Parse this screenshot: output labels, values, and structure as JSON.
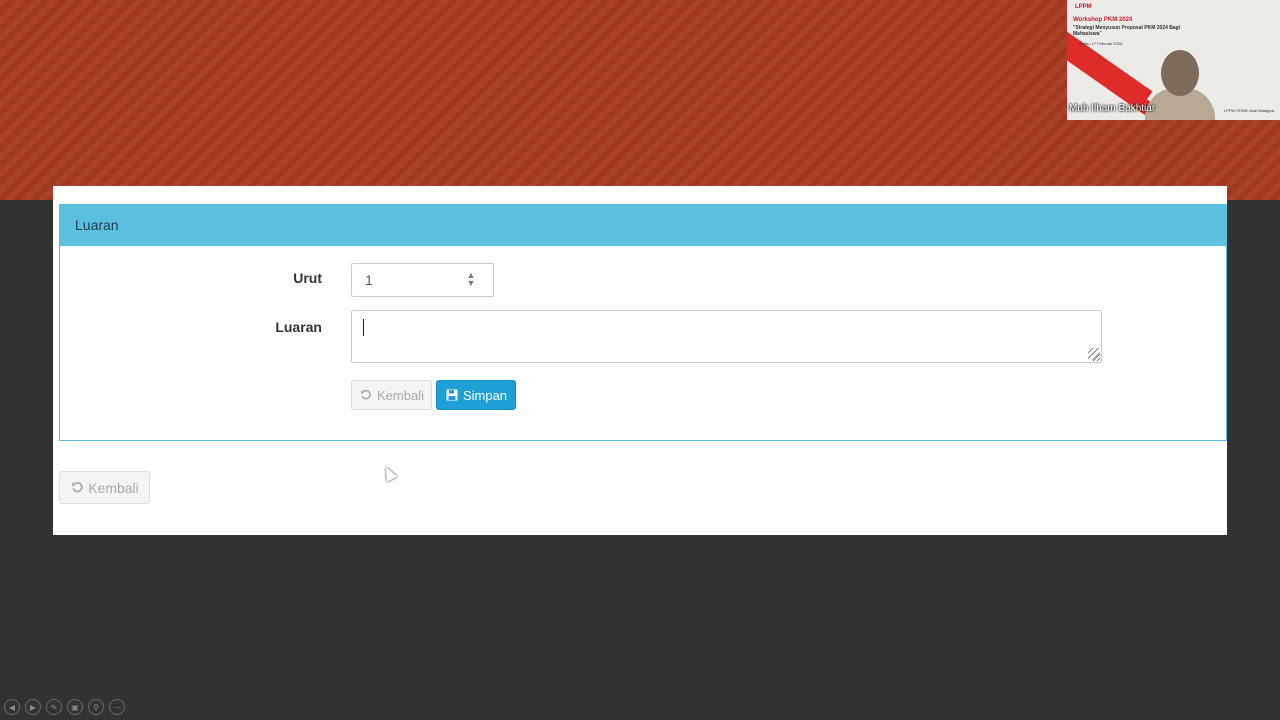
{
  "panel": {
    "heading": "Luaran"
  },
  "form": {
    "urut_label": "Urut",
    "urut_value": "1",
    "luaran_label": "Luaran",
    "luaran_value": ""
  },
  "buttons": {
    "kembali_label": "Kembali",
    "simpan_label": "Simpan",
    "bottom_kembali_label": "Kembali"
  },
  "webcam": {
    "logo": "LPPM",
    "slide_title": "Workshop PKM 2024",
    "slide_subtitle": "\"Strategi Menyusun Proposal PKM 2024 Bagi Mahasiswa\"",
    "slide_date": "Sabtu, 17 Februari 2024",
    "participant_name": "Muh Ilham Bakhtiar",
    "footer": "LPPM STMIK Andi Matappa"
  },
  "icons": {
    "undo": "undo-icon",
    "save": "floppy-disk-icon"
  },
  "colors": {
    "panel_info": "#5bc0de",
    "primary": "#1e9fd6",
    "banner": "#a73a22"
  }
}
